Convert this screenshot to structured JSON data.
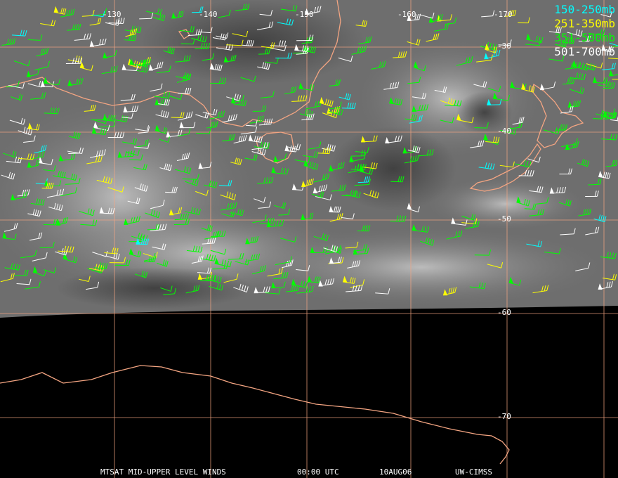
{
  "footer": {
    "product": "MTSAT MID-UPPER LEVEL WINDS",
    "time": "00:00 UTC",
    "date": "10AUG06",
    "source": "UW-CIMSS"
  },
  "legend": [
    {
      "label": "150-250mb",
      "color": "#00ffff"
    },
    {
      "label": "251-350mb",
      "color": "#ffff00"
    },
    {
      "label": "351-500mb",
      "color": "#00ff00"
    },
    {
      "label": "501-700mb",
      "color": "#ffffff"
    }
  ],
  "longitude_labels": [
    "-130",
    "-140",
    "-150",
    "-160",
    "-170"
  ],
  "latitude_labels": [
    "-30",
    "-40",
    "-50",
    "-60",
    "-70"
  ],
  "colors": {
    "grid": "#f4a582",
    "coast": "#f4a582",
    "space": "#000000"
  }
}
